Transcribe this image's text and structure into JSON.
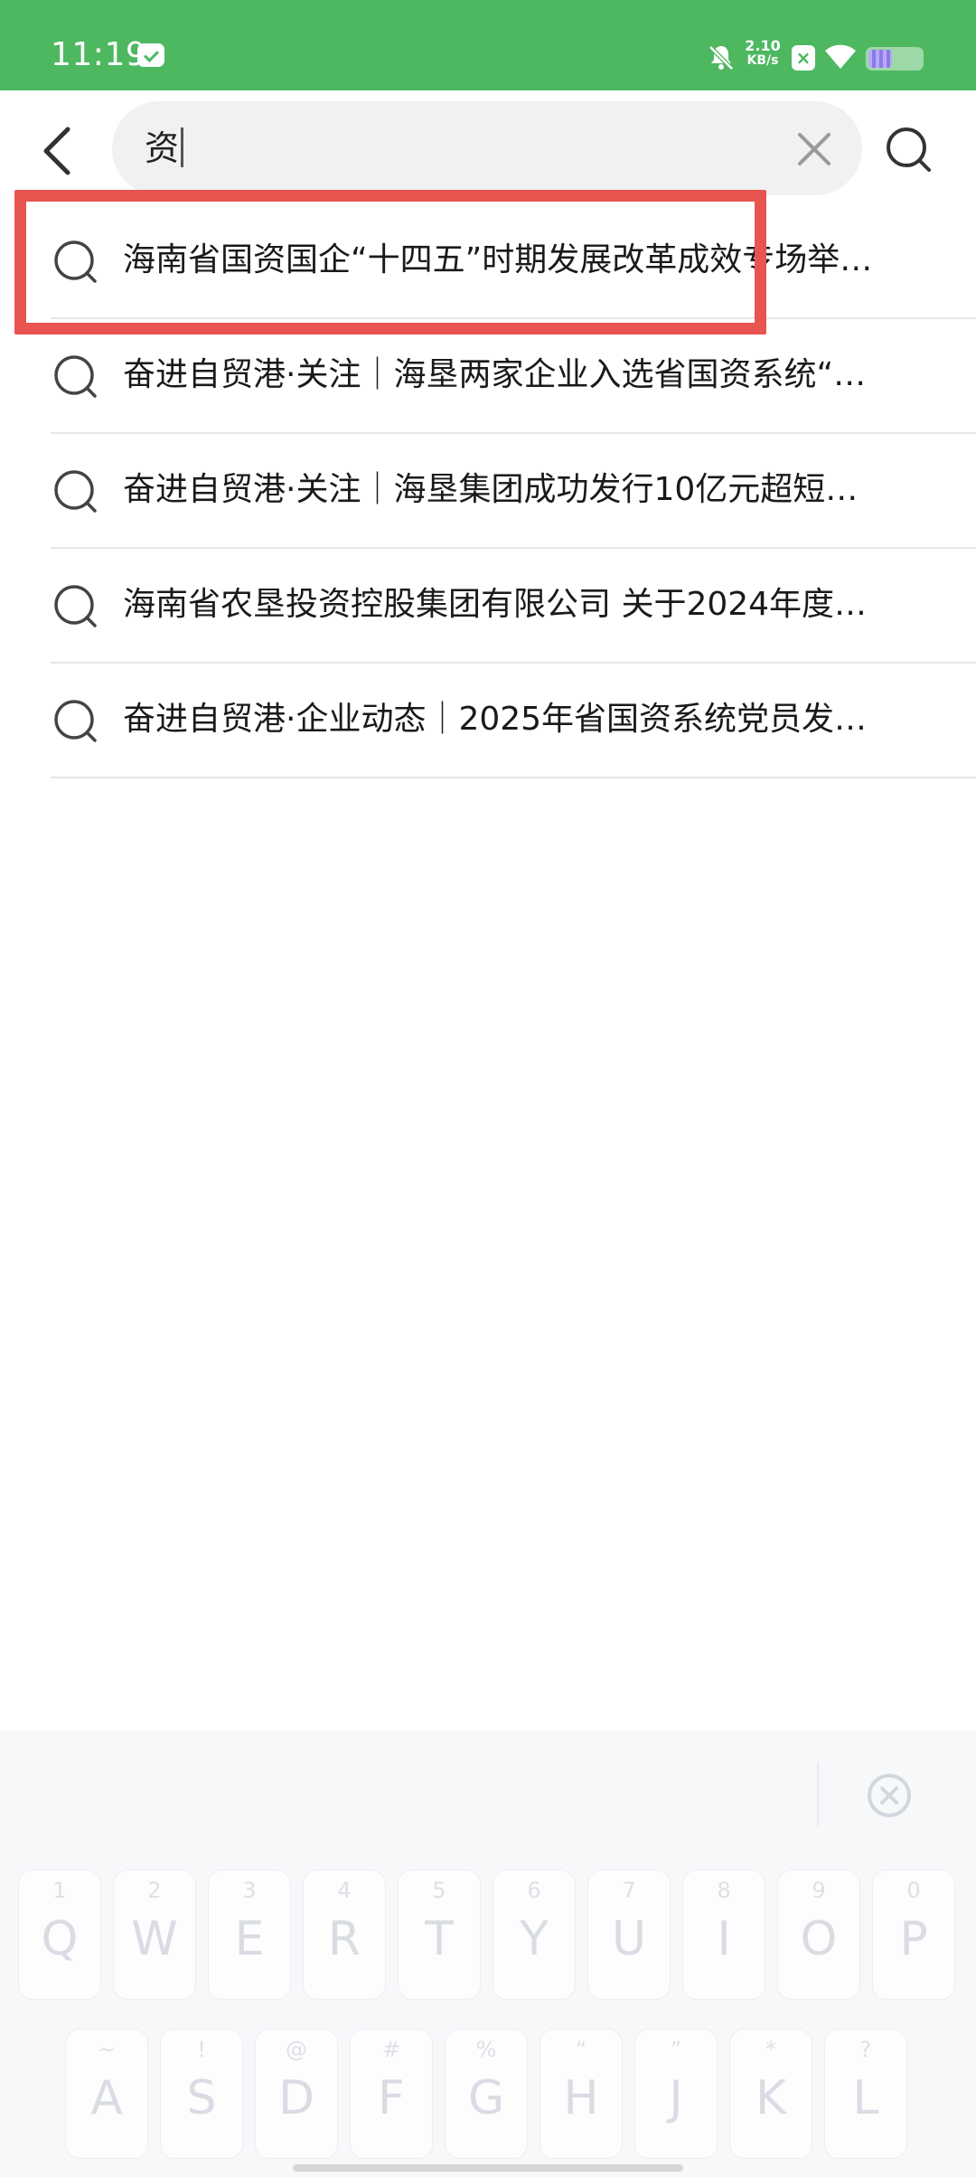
{
  "status_bar": {
    "time": "11:19",
    "net_speed_value": "2.10",
    "net_speed_unit": "KB/s",
    "icons": [
      "mail-icon",
      "mute-icon",
      "x-app-icon",
      "wifi-icon",
      "battery-icon"
    ],
    "background": "#4db860"
  },
  "search": {
    "query": "资",
    "back_icon": "chevron-left-icon",
    "clear_icon": "close-icon",
    "submit_icon": "search-icon"
  },
  "suggestions": [
    {
      "text": "海南省国资国企“十四五”时期发展改革成效专场举…"
    },
    {
      "text": "奋进自贸港·关注｜海垦两家企业入选省国资系统“…"
    },
    {
      "text": "奋进自贸港·关注｜海垦集团成功发行10亿元超短…"
    },
    {
      "text": "海南省农垦投资控股集团有限公司 关于2024年度…"
    },
    {
      "text": "奋进自贸港·企业动态｜2025年省国资系统党员发…"
    }
  ],
  "keyboard": {
    "row1": [
      {
        "sub": "1",
        "main": "Q"
      },
      {
        "sub": "2",
        "main": "W"
      },
      {
        "sub": "3",
        "main": "E"
      },
      {
        "sub": "4",
        "main": "R"
      },
      {
        "sub": "5",
        "main": "T"
      },
      {
        "sub": "6",
        "main": "Y"
      },
      {
        "sub": "7",
        "main": "U"
      },
      {
        "sub": "8",
        "main": "I"
      },
      {
        "sub": "9",
        "main": "O"
      },
      {
        "sub": "0",
        "main": "P"
      }
    ],
    "row2": [
      {
        "sub": "~",
        "main": "A"
      },
      {
        "sub": "!",
        "main": "S"
      },
      {
        "sub": "@",
        "main": "D"
      },
      {
        "sub": "#",
        "main": "F"
      },
      {
        "sub": "%",
        "main": "G"
      },
      {
        "sub": "“",
        "main": "H"
      },
      {
        "sub": "”",
        "main": "J"
      },
      {
        "sub": "*",
        "main": "K"
      },
      {
        "sub": "?",
        "main": "L"
      }
    ],
    "close_icon": "close-circle-icon"
  },
  "accent_color": "#e8544f"
}
